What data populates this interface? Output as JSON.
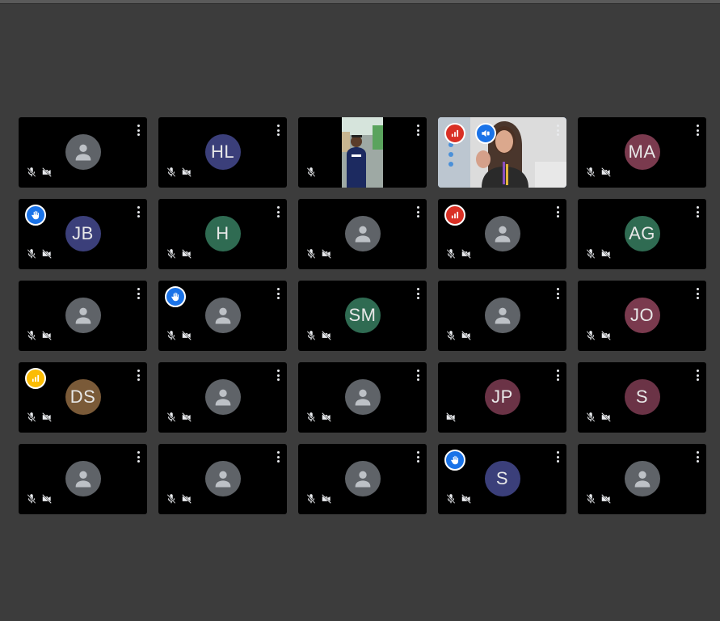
{
  "participants": [
    {
      "initials": "",
      "avatar_color": "#5f6368",
      "mic_muted": true,
      "cam_off": true,
      "badge": null
    },
    {
      "initials": "HL",
      "avatar_color": "#3b3f7a",
      "mic_muted": true,
      "cam_off": true,
      "badge": null
    },
    {
      "initials": "",
      "video": "man-standing",
      "mic_muted": true,
      "cam_off": false,
      "badge": null
    },
    {
      "initials": "",
      "video": "woman-speaking",
      "mic_muted": false,
      "cam_off": false,
      "badge": "audio-red",
      "presenting": true,
      "active": true
    },
    {
      "initials": "MA",
      "avatar_color": "#7a3a4e",
      "mic_muted": true,
      "cam_off": true,
      "badge": null
    },
    {
      "initials": "JB",
      "avatar_color": "#3b3f7a",
      "mic_muted": true,
      "cam_off": true,
      "badge": "hand"
    },
    {
      "initials": "H",
      "avatar_color": "#2f6b52",
      "mic_muted": true,
      "cam_off": true,
      "badge": null
    },
    {
      "initials": "",
      "avatar_color": "#5f6368",
      "mic_muted": true,
      "cam_off": true,
      "badge": null
    },
    {
      "initials": "",
      "avatar_color": "#5f6368",
      "mic_muted": true,
      "cam_off": true,
      "badge": "audio-red"
    },
    {
      "initials": "AG",
      "avatar_color": "#2f6b52",
      "mic_muted": true,
      "cam_off": true,
      "badge": null
    },
    {
      "initials": "",
      "avatar_color": "#5f6368",
      "mic_muted": true,
      "cam_off": true,
      "badge": null
    },
    {
      "initials": "",
      "avatar_color": "#5f6368",
      "mic_muted": true,
      "cam_off": true,
      "badge": "hand"
    },
    {
      "initials": "SM",
      "avatar_color": "#2f6b52",
      "mic_muted": true,
      "cam_off": true,
      "badge": null
    },
    {
      "initials": "",
      "avatar_color": "#5f6368",
      "mic_muted": true,
      "cam_off": true,
      "badge": null
    },
    {
      "initials": "JO",
      "avatar_color": "#7a3a4e",
      "mic_muted": true,
      "cam_off": true,
      "badge": null
    },
    {
      "initials": "DS",
      "avatar_color": "#7a5a38",
      "mic_muted": true,
      "cam_off": true,
      "badge": "audio-yellow"
    },
    {
      "initials": "",
      "avatar_color": "#5f6368",
      "mic_muted": true,
      "cam_off": true,
      "badge": null
    },
    {
      "initials": "",
      "avatar_color": "#5f6368",
      "mic_muted": true,
      "cam_off": true,
      "badge": null
    },
    {
      "initials": "JP",
      "avatar_color": "#6b3346",
      "mic_muted": false,
      "cam_off": true,
      "badge": null
    },
    {
      "initials": "S",
      "avatar_color": "#6b3346",
      "mic_muted": true,
      "cam_off": true,
      "badge": null
    },
    {
      "initials": "",
      "avatar_color": "#5f6368",
      "mic_muted": true,
      "cam_off": true,
      "badge": null
    },
    {
      "initials": "",
      "avatar_color": "#5f6368",
      "mic_muted": true,
      "cam_off": true,
      "badge": null
    },
    {
      "initials": "",
      "avatar_color": "#5f6368",
      "mic_muted": true,
      "cam_off": true,
      "badge": null
    },
    {
      "initials": "S",
      "avatar_color": "#3b3f7a",
      "mic_muted": true,
      "cam_off": true,
      "badge": "hand"
    },
    {
      "initials": "",
      "avatar_color": "#5f6368",
      "mic_muted": true,
      "cam_off": true,
      "badge": null
    }
  ],
  "colors": {
    "background": "#3c3c3c",
    "tile": "#000000",
    "active_border": "#1a73e8",
    "hand_badge": "#1a73e8",
    "audio_red": "#d93025",
    "audio_yellow": "#fbbc04"
  }
}
